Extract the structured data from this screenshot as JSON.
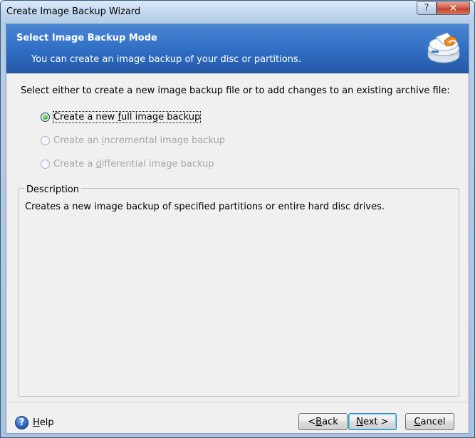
{
  "window": {
    "title": "Create Image Backup Wizard",
    "help_glyph": "?",
    "close_glyph": "✕"
  },
  "banner": {
    "title": "Select Image Backup Mode",
    "subtitle": "You can create an image backup of your disc or partitions."
  },
  "instruction": "Select either to create a new image backup file or to add changes to an existing archive file:",
  "options": [
    {
      "pre": "Create a new ",
      "mnemonic": "f",
      "post": "ull image backup",
      "checked": true,
      "enabled": true
    },
    {
      "pre": "Create an ",
      "mnemonic": "i",
      "post": "ncremental image backup",
      "checked": false,
      "enabled": false
    },
    {
      "pre": "Create a ",
      "mnemonic": "d",
      "post": "ifferential image backup",
      "checked": false,
      "enabled": false
    }
  ],
  "description": {
    "title": "Description",
    "text": "Creates a new image backup of specified partitions or entire hard disc drives."
  },
  "footer": {
    "help_icon": "?",
    "help": {
      "mnemonic": "H",
      "post": "elp"
    },
    "back": {
      "pre": "< ",
      "mnemonic": "B",
      "post": "ack"
    },
    "next": {
      "pre": "",
      "mnemonic": "N",
      "post": "ext >"
    },
    "cancel": {
      "pre": "",
      "mnemonic": "C",
      "post": "ancel"
    }
  },
  "colors": {
    "banner": "#2f6ec4",
    "selected_radio": "#39b524",
    "disabled_text": "#a6a6a6"
  }
}
